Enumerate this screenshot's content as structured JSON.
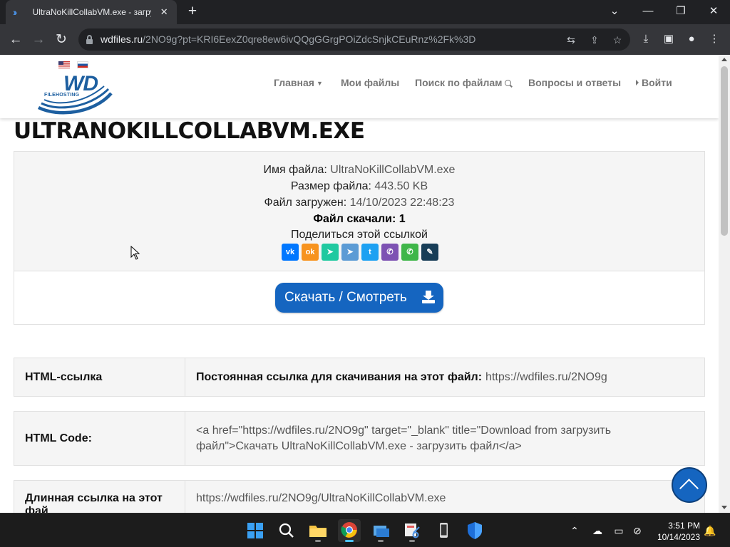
{
  "browser": {
    "tab_title": "UltraNoKillCollabVM.exe - загру",
    "tab_close": "✕",
    "new_tab": "+",
    "url_host": "wdfiles.ru",
    "url_path": "/2NO9g?pt=KRI6EexZ0qre8ew6ivQQgGGrgPOiZdcSnjkCEuRnz%2Fk%3D",
    "controls": {
      "dropdown": "⌄",
      "minimize": "—",
      "restore": "❐",
      "close": "✕"
    }
  },
  "site": {
    "nav": {
      "home": "Главная",
      "my_files": "Мои файлы",
      "file_search": "Поиск по файлам",
      "faq": "Вопросы и ответы",
      "login": "Войти"
    },
    "logo": {
      "letters": "WD",
      "tagline": "FILEHOSTING"
    }
  },
  "file": {
    "title": "ULTRANOKILLCOLLABVM.EXE",
    "name_label": "Имя файла:",
    "name_value": "UltraNoKillCollabVM.exe",
    "size_label": "Размер файла:",
    "size_value": "443.50 KB",
    "uploaded_label": "Файл загружен:",
    "uploaded_value": "14/10/2023 22:48:23",
    "downloads_text": "Файл скачали: 1",
    "share_text": "Поделиться этой ссылкой",
    "download_button": "Скачать / Смотреть"
  },
  "share_buttons": [
    {
      "name": "vk",
      "glyph": "vk",
      "color": "#0077ff"
    },
    {
      "name": "odnoklassniki",
      "glyph": "ok",
      "color": "#f7931e"
    },
    {
      "name": "moimir",
      "glyph": "➤",
      "color": "#20c9a0"
    },
    {
      "name": "telegram",
      "glyph": "➤",
      "color": "#5b9bd5"
    },
    {
      "name": "twitter",
      "glyph": "t",
      "color": "#1da1f2"
    },
    {
      "name": "viber",
      "glyph": "✆",
      "color": "#7d52b3"
    },
    {
      "name": "whatsapp",
      "glyph": "✆",
      "color": "#3fb649"
    },
    {
      "name": "livejournal",
      "glyph": "✎",
      "color": "#173d57"
    }
  ],
  "rows": {
    "html_link": {
      "key": "HTML-ссылка",
      "value_bold": "Постоянная ссылка для скачивания на этот файл:",
      "value": "https://wdfiles.ru/2NO9g"
    },
    "html_code": {
      "key": "HTML Code:",
      "value": "<a href=\"https://wdfiles.ru/2NO9g\" target=\"_blank\" title=\"Download from загрузить файл\">Скачать UltraNoKillCollabVM.exe - загрузить файл</a>"
    },
    "long_link": {
      "key": "Длинная ссылка на этот фай",
      "value": "https://wdfiles.ru/2NO9g/UltraNoKillCollabVM.exe"
    }
  },
  "taskbar": {
    "time": "3:51 PM",
    "date": "10/14/2023"
  },
  "colors": {
    "accent": "#1565c0",
    "chrome_bg": "#202124",
    "chrome_toolbar": "#35363a"
  }
}
